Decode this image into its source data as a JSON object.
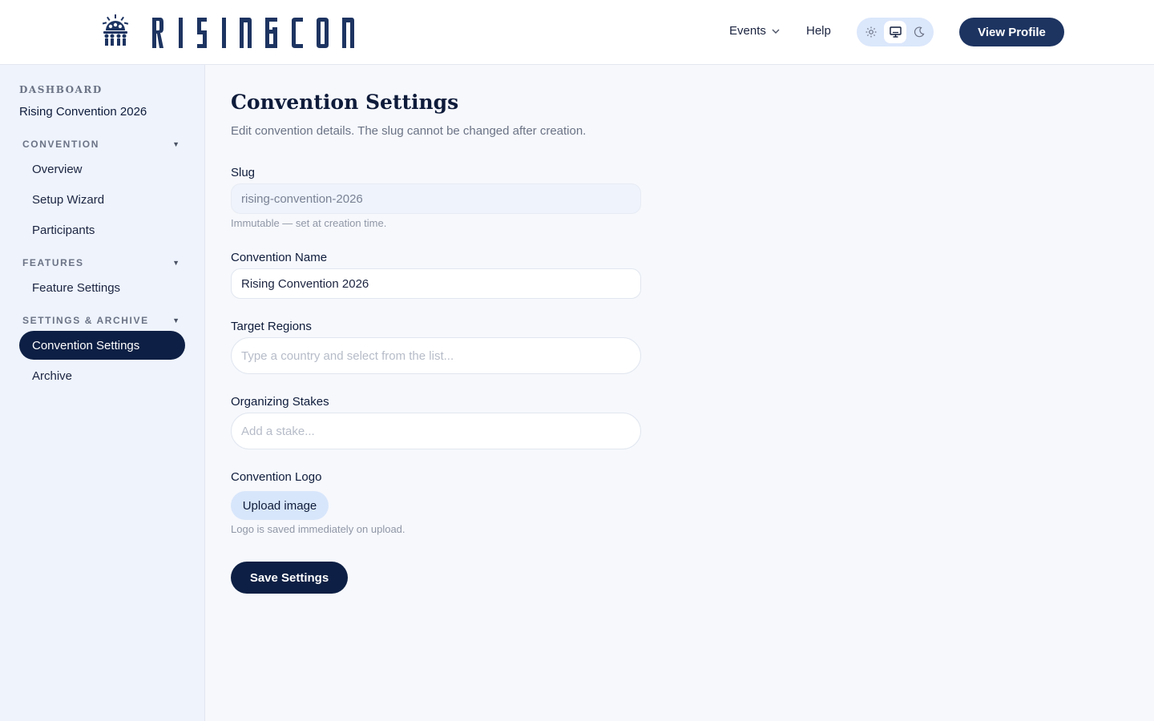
{
  "header": {
    "logo_text": "RISINGCON",
    "nav": {
      "events_label": "Events",
      "help_label": "Help"
    },
    "theme_options": [
      "light",
      "system",
      "dark"
    ],
    "theme_selected": "system",
    "view_profile_label": "View Profile"
  },
  "sidebar": {
    "dashboard_label": "DASHBOARD",
    "dashboard_value": "Rising Convention 2026",
    "sections": [
      {
        "title": "CONVENTION",
        "items": [
          "Overview",
          "Setup Wizard",
          "Participants"
        ]
      },
      {
        "title": "FEATURES",
        "items": [
          "Feature Settings"
        ]
      },
      {
        "title": "SETTINGS & ARCHIVE",
        "items": [
          "Convention Settings",
          "Archive"
        ]
      }
    ],
    "active_item": "Convention Settings"
  },
  "main": {
    "title": "Convention Settings",
    "subtitle": "Edit convention details. The slug cannot be changed after creation.",
    "slug": {
      "label": "Slug",
      "value": "rising-convention-2026",
      "hint": "Immutable — set at creation time."
    },
    "name": {
      "label": "Convention Name",
      "value": "Rising Convention 2026"
    },
    "regions": {
      "label": "Target Regions",
      "placeholder": "Type a country and select from the list..."
    },
    "stakes": {
      "label": "Organizing Stakes",
      "placeholder": "Add a stake..."
    },
    "logo": {
      "label": "Convention Logo",
      "upload_label": "Upload image",
      "hint": "Logo is saved immediately on upload."
    },
    "save_label": "Save Settings"
  },
  "colors": {
    "navy": "#0d1f44",
    "button_navy": "#1d3461",
    "sidebar_bg": "#eef3fc",
    "page_bg": "#f6f8fc",
    "upload_bg": "#d8e6fb",
    "muted_text": "#6b7385"
  }
}
